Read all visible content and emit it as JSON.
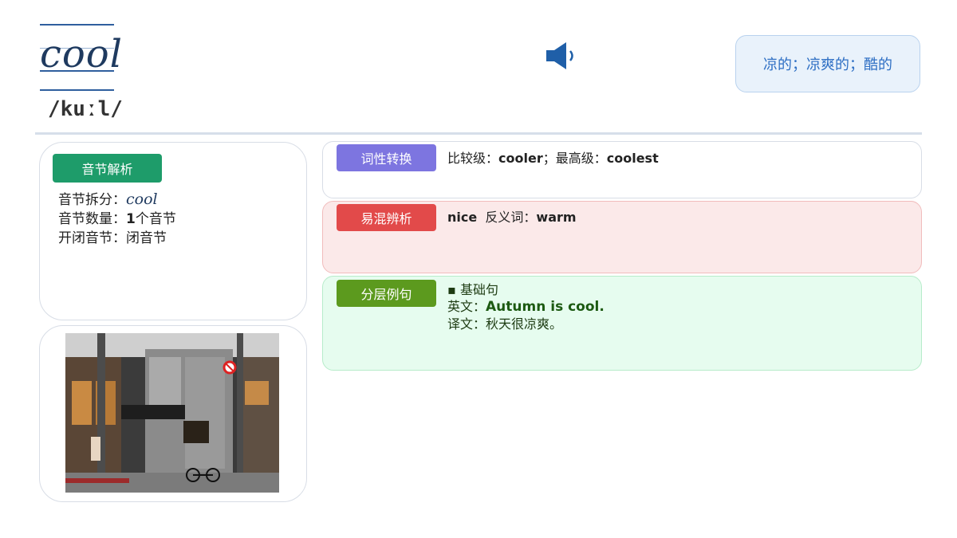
{
  "word": {
    "text": "cool",
    "phonetic": "/kuːl/"
  },
  "speaker": {
    "icon": "speaker-icon"
  },
  "meaning": "凉的；凉爽的；酷的",
  "syllable": {
    "tag": "音节解析",
    "split_label": "音节拆分：",
    "split_value": "cool",
    "count_label": "音节数量：",
    "count_value": "1",
    "count_unit": "个音节",
    "type_label": "开闭音节：",
    "type_value": "闭音节"
  },
  "pos": {
    "tag": "词性转换",
    "comparative_label": "比较级：",
    "comparative_value": "cooler",
    "sep": "；",
    "superlative_label": "最高级：",
    "superlative_value": "coolest"
  },
  "confuse": {
    "tag": "易混辨析",
    "similar": "nice",
    "antonym_label": "反义词：",
    "antonym_value": "warm"
  },
  "examples": {
    "tag": "分层例句",
    "level": "基础句",
    "en_label": "英文：",
    "en_value": "Autumn is cool.",
    "zh_label": "译文：",
    "zh_value": "秋天很凉爽。"
  },
  "colors": {
    "primary": "#2f5f9e",
    "syllable_tag": "#1e9c6a",
    "pos_tag": "#7d75e0",
    "confuse_tag": "#e24a4a",
    "examples_tag": "#5c9a1e",
    "meaning_text": "#2e6fc4"
  }
}
